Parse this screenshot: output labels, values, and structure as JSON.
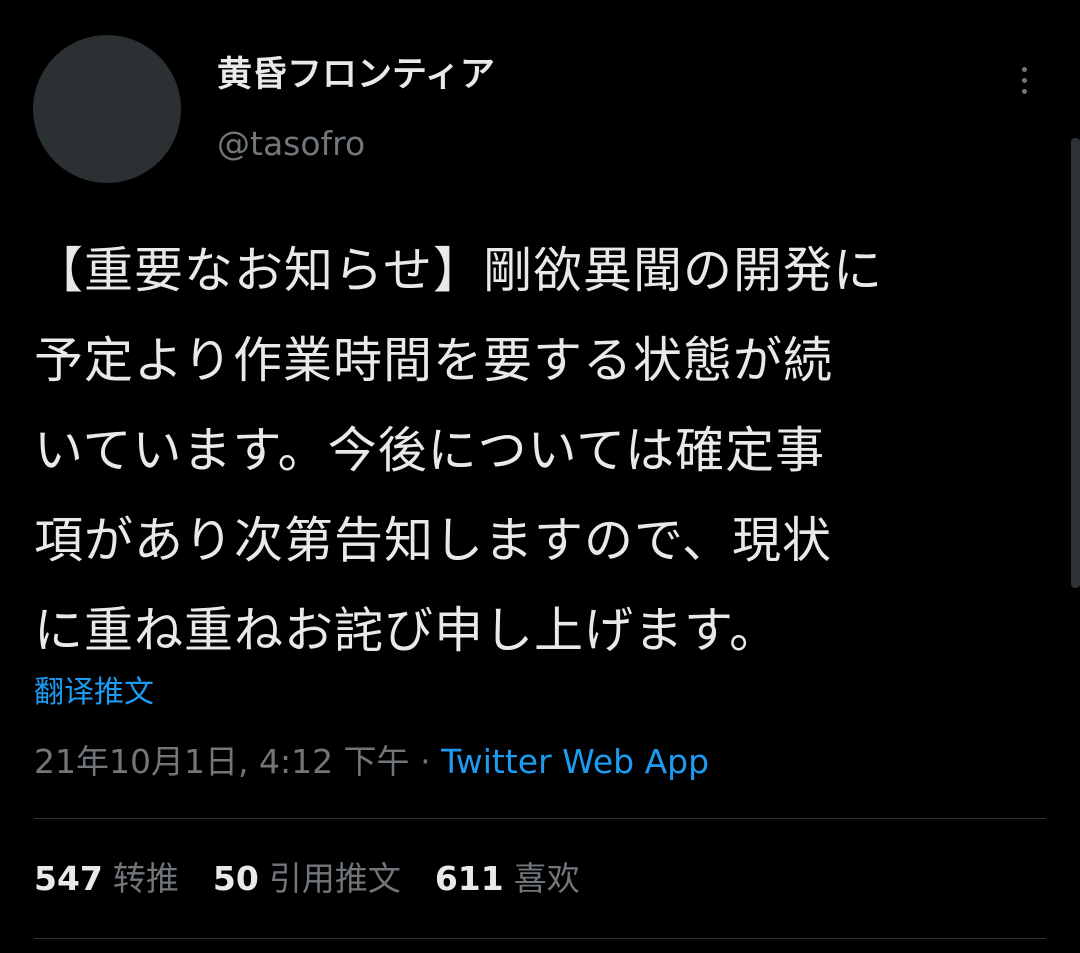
{
  "author": {
    "display_name": "黄昏フロンティア",
    "handle": "@tasofro"
  },
  "tweet": {
    "lines": [
      "【重要なお知らせ】剛欲異聞の開発に",
      "予定より作業時間を要する状態が続",
      "いています。今後については確定事",
      "項があり次第告知しますので、現状",
      "に重ね重ねお詫び申し上げます。"
    ]
  },
  "translate_label": "翻译推文",
  "meta": {
    "timestamp": "21年10月1日, 4:12 下午",
    "separator": "·",
    "source": "Twitter Web App"
  },
  "stats": {
    "retweets_count": "547",
    "retweets_label": "转推",
    "quotes_count": "50",
    "quotes_label": "引用推文",
    "likes_count": "611",
    "likes_label": "喜欢"
  },
  "colors": {
    "background": "#000000",
    "text": "#e7e9ea",
    "secondary": "#71767b",
    "accent": "#1d9bf0",
    "divider": "#2f3336"
  },
  "icons": {
    "more": "more-vertical-icon"
  }
}
